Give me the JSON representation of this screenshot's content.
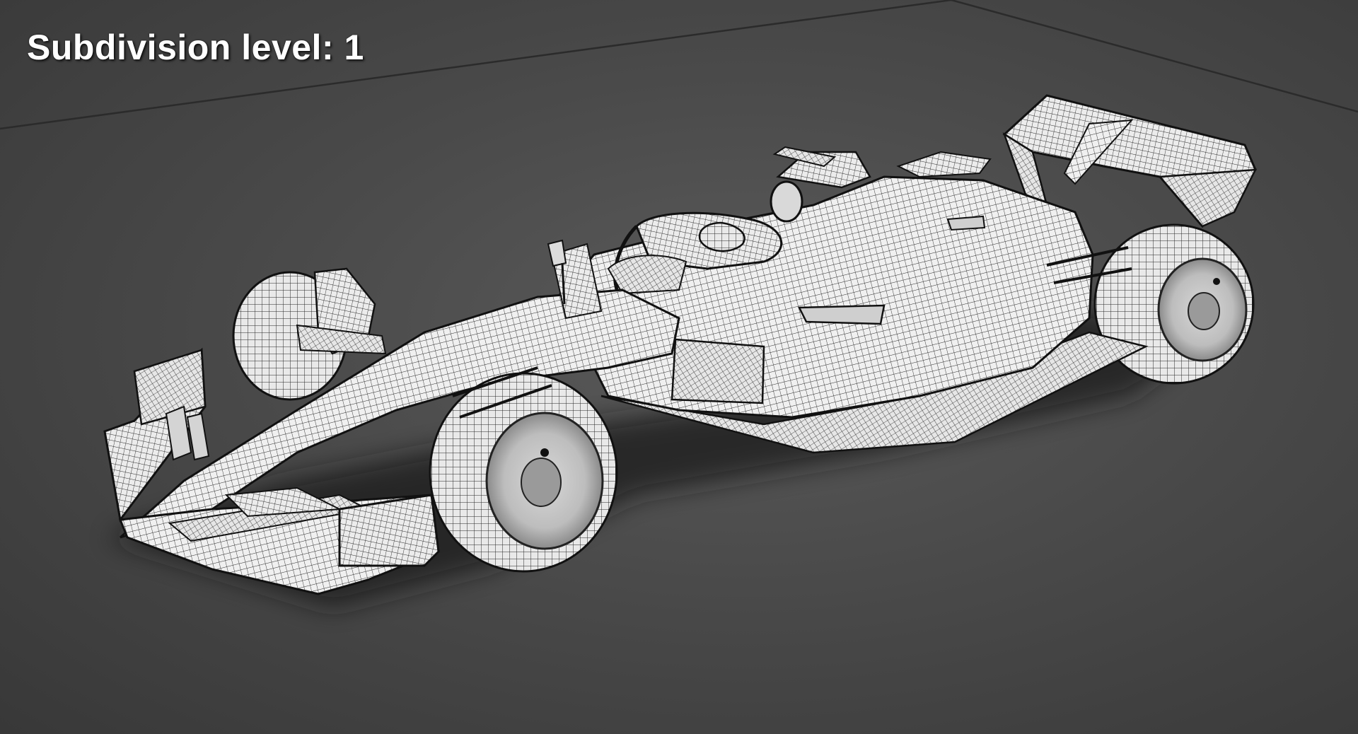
{
  "overlay": {
    "label": "Subdivision level: 1"
  },
  "scene": {
    "subject": "f1-car-wireframe-render",
    "colors": {
      "floor": "#4a4a4a",
      "floor_dark": "#383838",
      "body": "#eeeeee",
      "wire": "#2a2a2a",
      "shadow": "#1e1e1e",
      "horizon_line": "#2b2b2b"
    }
  }
}
